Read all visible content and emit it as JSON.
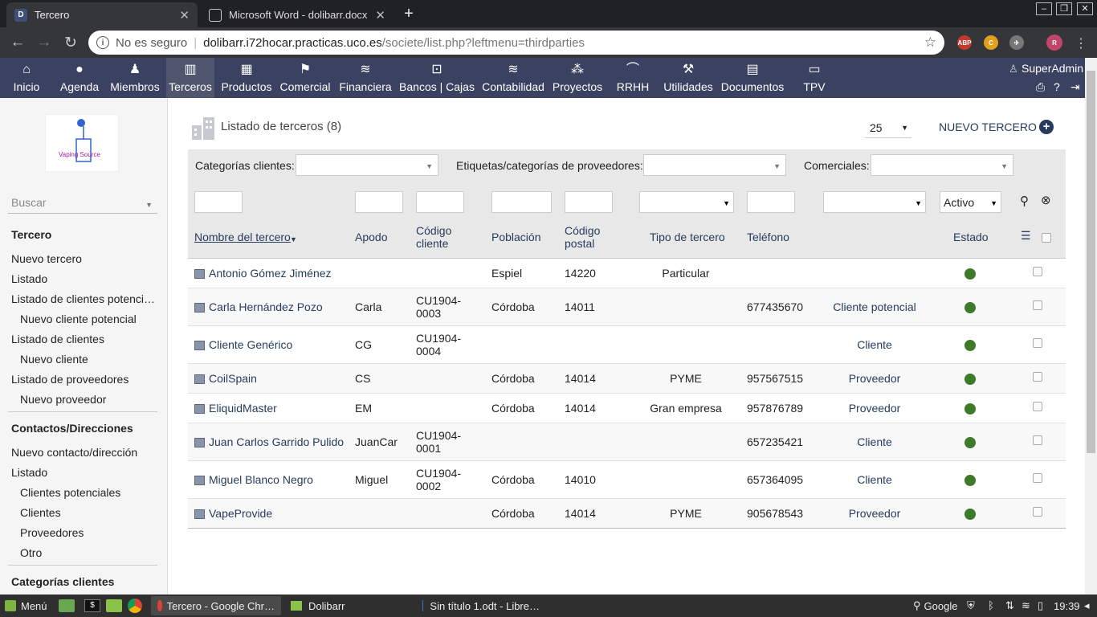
{
  "browser": {
    "tabs": [
      {
        "title": "Tercero",
        "favicon": "D",
        "active": true
      },
      {
        "title": "Microsoft Word - dolibarr.docx",
        "favicon": "doc-icon",
        "active": false
      }
    ],
    "security_text": "No es seguro",
    "url_host": "dolibarr.i72hocar.practicas.uco.es",
    "url_path": "/societe/list.php?leftmenu=thirdparties"
  },
  "topmenu": {
    "items": [
      {
        "label": "Inicio",
        "icon": "home-icon"
      },
      {
        "label": "Agenda",
        "icon": "agenda-icon"
      },
      {
        "label": "Miembros",
        "icon": "members-icon"
      },
      {
        "label": "Terceros",
        "icon": "company-icon",
        "selected": true
      },
      {
        "label": "Productos",
        "icon": "products-icon"
      },
      {
        "label": "Comercial",
        "icon": "commercial-icon"
      },
      {
        "label": "Financiera",
        "icon": "billing-icon"
      },
      {
        "label": "Bancos | Cajas",
        "icon": "bank-icon"
      },
      {
        "label": "Contabilidad",
        "icon": "accounting-icon"
      },
      {
        "label": "Proyectos",
        "icon": "projects-icon"
      },
      {
        "label": "RRHH",
        "icon": "hrm-icon"
      },
      {
        "label": "Utilidades",
        "icon": "tools-icon"
      },
      {
        "label": "Documentos",
        "icon": "documents-icon"
      },
      {
        "label": "TPV",
        "icon": "pos-icon"
      }
    ],
    "user": "SuperAdmin",
    "accent": "#3b4261"
  },
  "sidebar": {
    "search_placeholder": "Buscar",
    "logo_text": "Vaping Source",
    "sections": [
      {
        "items": [
          {
            "label": "Tercero",
            "level": 0
          },
          {
            "label": "Nuevo tercero",
            "level": 1
          },
          {
            "label": "Listado",
            "level": 1
          },
          {
            "label": "Listado de clientes potenci…",
            "level": 1
          },
          {
            "label": "Nuevo cliente potencial",
            "level": 2
          },
          {
            "label": "Listado de clientes",
            "level": 1
          },
          {
            "label": "Nuevo cliente",
            "level": 2
          },
          {
            "label": "Listado de proveedores",
            "level": 1
          },
          {
            "label": "Nuevo proveedor",
            "level": 2
          }
        ]
      },
      {
        "items": [
          {
            "label": "Contactos/Direcciones",
            "level": 0
          },
          {
            "label": "Nuevo contacto/dirección",
            "level": 1
          },
          {
            "label": "Listado",
            "level": 1
          },
          {
            "label": "Clientes potenciales",
            "level": 2
          },
          {
            "label": "Clientes",
            "level": 2
          },
          {
            "label": "Proveedores",
            "level": 2
          },
          {
            "label": "Otro",
            "level": 2
          }
        ]
      },
      {
        "items": [
          {
            "label": "Categorías clientes",
            "level": 0
          }
        ]
      }
    ]
  },
  "main": {
    "title": "Listado de terceros (8)",
    "limit": "25",
    "new_button": "NUEVO TERCERO",
    "filters": {
      "cat_clients_label": "Categorías clientes:",
      "cat_suppliers_label": "Etiquetas/categorías de proveedores:",
      "sales_label": "Comerciales:",
      "status_value": "Activo"
    },
    "columns": [
      "Nombre del tercero",
      "Apodo",
      "Código cliente",
      "Población",
      "Código postal",
      "Tipo de tercero",
      "Teléfono",
      "",
      "Estado"
    ],
    "rows": [
      {
        "name": "Antonio Gómez Jiménez",
        "alias": "",
        "code": "",
        "town": "Espiel",
        "zip": "14220",
        "type": "Particular",
        "phone": "",
        "nature": "",
        "status": "active"
      },
      {
        "name": "Carla Hernández Pozo",
        "alias": "Carla",
        "code": "CU1904-0003",
        "town": "Córdoba",
        "zip": "14011",
        "type": "",
        "phone": "677435670",
        "nature": "Cliente potencial",
        "status": "active"
      },
      {
        "name": "Cliente Genérico",
        "alias": "CG",
        "code": "CU1904-0004",
        "town": "",
        "zip": "",
        "type": "",
        "phone": "",
        "nature": "Cliente",
        "status": "active"
      },
      {
        "name": "CoilSpain",
        "alias": "CS",
        "code": "",
        "town": "Córdoba",
        "zip": "14014",
        "type": "PYME",
        "phone": "957567515",
        "nature": "Proveedor",
        "status": "active"
      },
      {
        "name": "EliquidMaster",
        "alias": "EM",
        "code": "",
        "town": "Córdoba",
        "zip": "14014",
        "type": "Gran empresa",
        "phone": "957876789",
        "nature": "Proveedor",
        "status": "active"
      },
      {
        "name": "Juan Carlos Garrido Pulido",
        "alias": "JuanCar",
        "code": "CU1904-0001",
        "town": "",
        "zip": "",
        "type": "",
        "phone": "657235421",
        "nature": "Cliente",
        "status": "active"
      },
      {
        "name": "Miguel Blanco Negro",
        "alias": "Miguel",
        "code": "CU1904-0002",
        "town": "Córdoba",
        "zip": "14010",
        "type": "",
        "phone": "657364095",
        "nature": "Cliente",
        "status": "active"
      },
      {
        "name": "VapeProvide",
        "alias": "",
        "code": "",
        "town": "Córdoba",
        "zip": "14014",
        "type": "PYME",
        "phone": "905678543",
        "nature": "Proveedor",
        "status": "active"
      }
    ],
    "status_color": "#3d7a2a"
  },
  "taskbar": {
    "menu": "Menú",
    "windows": [
      {
        "label": "Tercero - Google Chr…",
        "active": true
      },
      {
        "label": "Dolibarr",
        "active": false
      },
      {
        "label": "Sin título 1.odt - Libre…",
        "active": false
      }
    ],
    "search": "Google",
    "time": "19:39"
  }
}
